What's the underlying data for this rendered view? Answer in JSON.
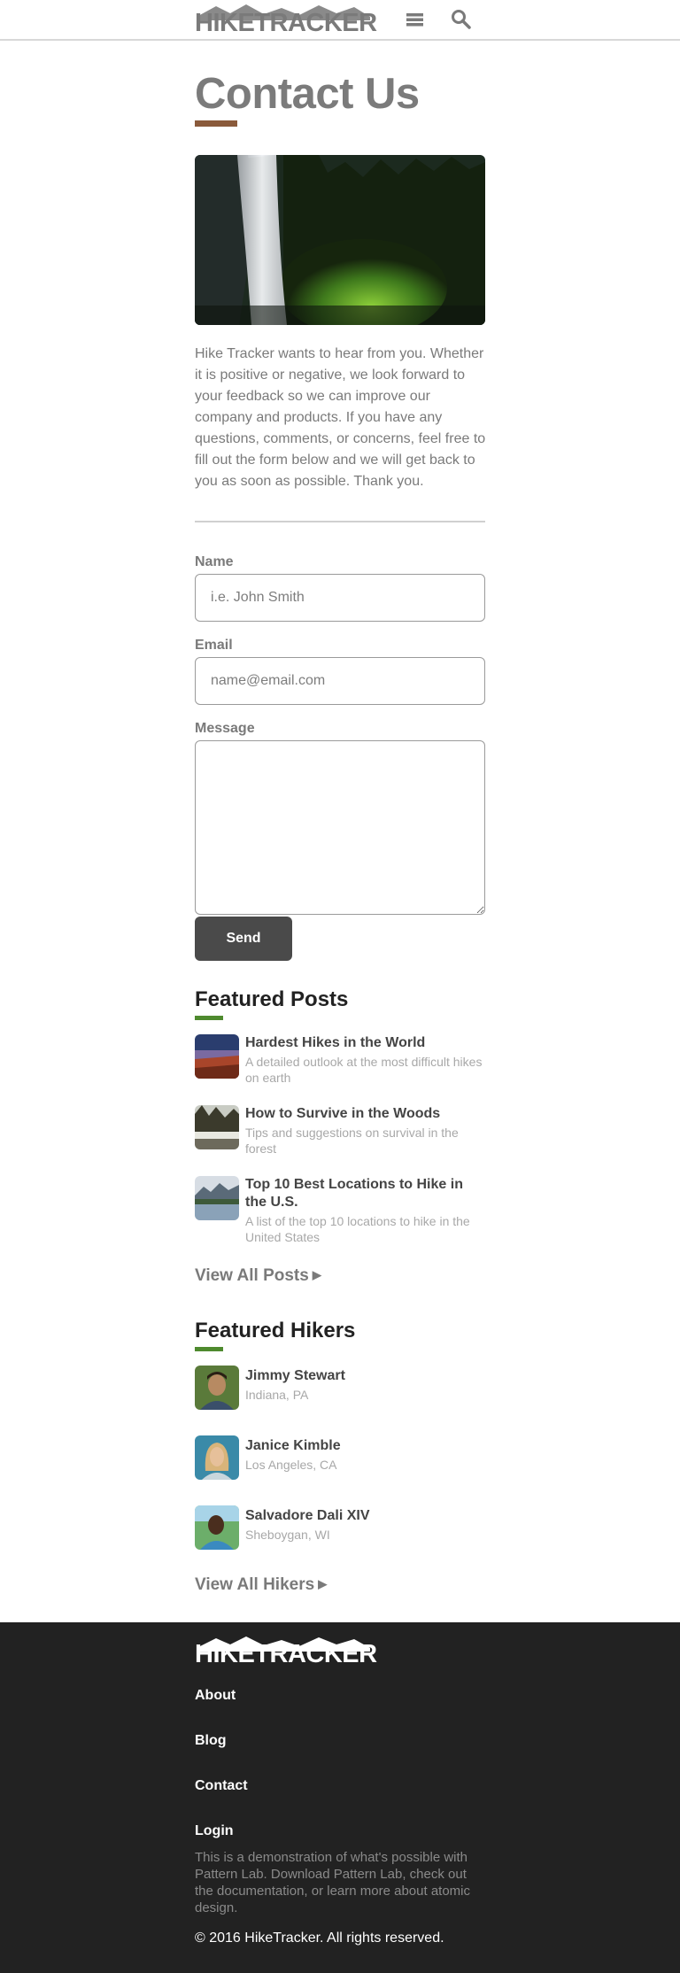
{
  "header": {
    "logo_text": "HIKETRACKER",
    "menu_icon": "menu-icon",
    "search_icon": "search-icon"
  },
  "page": {
    "title": "Contact Us",
    "intro": "Hike Tracker wants to hear from you. Whether it is positive or negative, we look forward to your feedback so we can improve our company and products. If you have any questions, comments, or concerns, feel free to fill out the form below and we will get back to you as soon as possible. Thank you."
  },
  "form": {
    "name_label": "Name",
    "name_placeholder": "i.e. John Smith",
    "name_value": "",
    "email_label": "Email",
    "email_placeholder": "name@email.com",
    "email_value": "",
    "message_label": "Message",
    "message_value": "",
    "send_label": "Send"
  },
  "featured_posts": {
    "title": "Featured Posts",
    "items": [
      {
        "title": "Hardest Hikes in the World",
        "desc": "A detailed outlook at the most difficult hikes on earth"
      },
      {
        "title": "How to Survive in the Woods",
        "desc": "Tips and suggestions on survival in the forest"
      },
      {
        "title": "Top 10 Best Locations to Hike in the U.S.",
        "desc": "A list of the top 10 locations to hike in the United States"
      }
    ],
    "view_all": "View All Posts"
  },
  "featured_hikers": {
    "title": "Featured Hikers",
    "items": [
      {
        "name": "Jimmy Stewart",
        "location": "Indiana, PA"
      },
      {
        "name": "Janice Kimble",
        "location": "Los Angeles, CA"
      },
      {
        "name": "Salvadore Dali XIV",
        "location": "Sheboygan, WI"
      }
    ],
    "view_all": "View All Hikers"
  },
  "footer": {
    "logo_text": "HIKETRACKER",
    "links": [
      "About",
      "Blog",
      "Contact",
      "Login"
    ],
    "blurb": "This is a demonstration of what's possible with Pattern Lab. Download Pattern Lab, check out the documentation, or learn more about atomic design.",
    "copyright": "© 2016 HikeTracker. All rights reserved."
  },
  "colors": {
    "brown_accent": "#8a5a3b",
    "green_accent": "#4e8a2e",
    "button": "#4a4a4a",
    "footer_bg": "#222222"
  }
}
